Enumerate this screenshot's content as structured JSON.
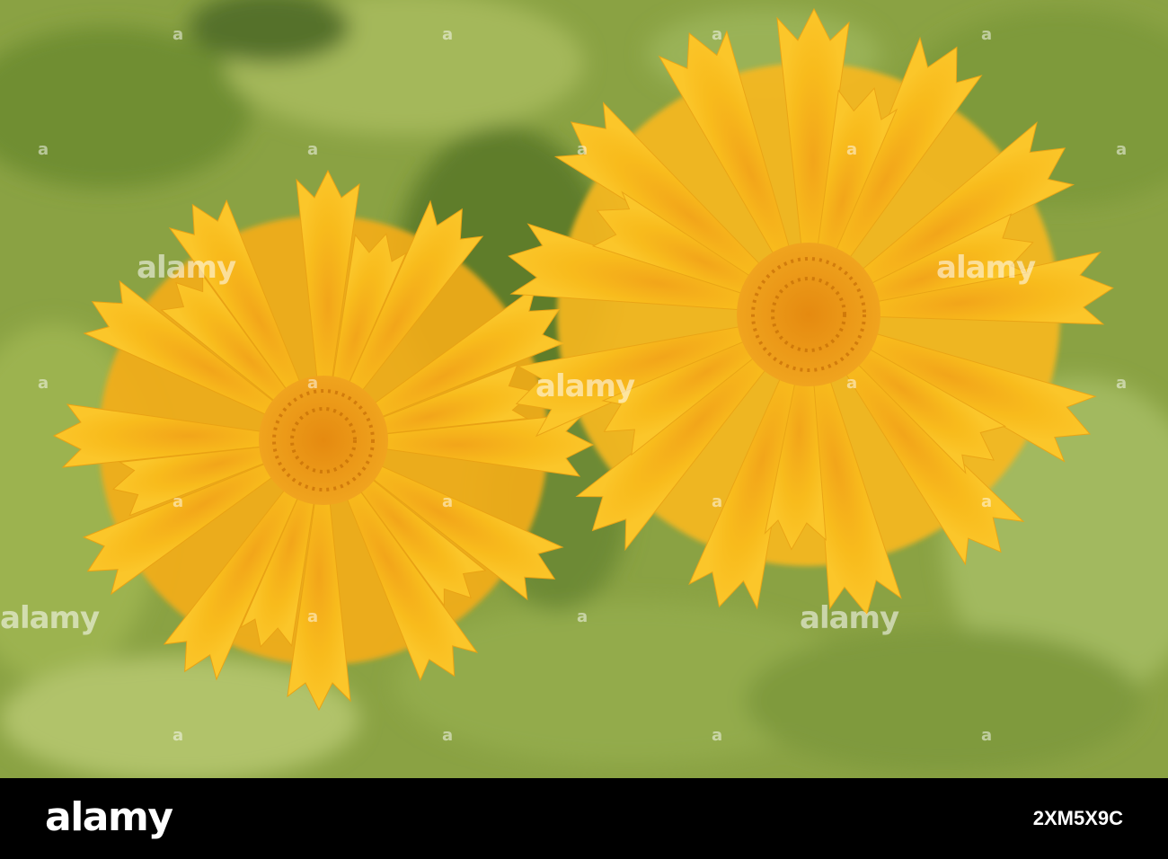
{
  "watermark": {
    "text": "alamy",
    "code": "a"
  },
  "footer": {
    "logo": "alamy",
    "image_id": "2XM5X9C"
  },
  "colors": {
    "leaf": "#8fa84a",
    "petal": "#f6b81a",
    "center": "#e08a0f",
    "footer_bg": "#000000"
  }
}
